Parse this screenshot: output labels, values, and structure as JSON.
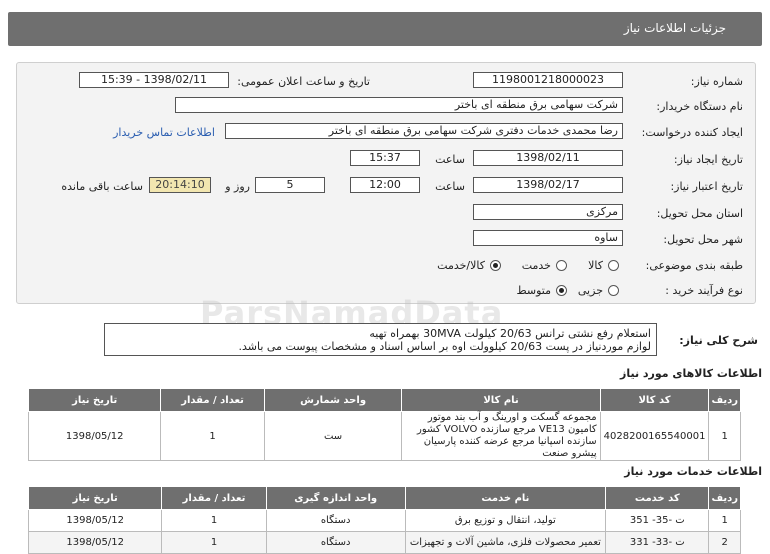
{
  "header": {
    "title": "جزئیات اطلاعات نیاز"
  },
  "form": {
    "need_number_label": "شماره نیاز:",
    "need_number": "1198001218000023",
    "announce_label": "تاریخ و ساعت اعلان عمومی:",
    "announce_value": "1398/02/11 - 15:39",
    "buyer_label": "نام دستگاه خریدار:",
    "buyer": "شرکت سهامی برق منطقه ای باختر",
    "requester_label": "ایجاد کننده درخواست:",
    "requester": "رضا محمدی خدمات دفتری شرکت سهامی برق منطقه ای باختر",
    "contact_link": "اطلاعات تماس خریدار",
    "created_label": "تاریخ ایجاد نیاز:",
    "created_date": "1398/02/11",
    "time_label": "ساعت",
    "created_time": "15:37",
    "valid_label": "تاریخ اعتبار نیاز:",
    "valid_date": "1398/02/17",
    "valid_time": "12:00",
    "days": "5",
    "days_label": "روز و",
    "remaining": "20:14:10",
    "remaining_label": "ساعت باقی مانده",
    "province_label": "استان محل تحویل:",
    "province": "مرکزی",
    "city_label": "شهر محل تحویل:",
    "city": "ساوه",
    "category_label": "طبقه بندی موضوعی:",
    "category_options": [
      "کالا",
      "خدمت",
      "کالا/خدمت"
    ],
    "category_selected": 2,
    "process_label": "نوع فرآیند خرید :",
    "process_options": [
      "جزیی",
      "متوسط"
    ],
    "process_selected": 1
  },
  "watermark": {
    "text": "ParsNamadData"
  },
  "description": {
    "label": "شرح کلی نیاز:",
    "line1": "استعلام رفع نشتی ترانس 20/63 کیلولت 30MVA بهمراه تهیه",
    "line2": "لوازم موردنیاز در پست 20/63 کیلوولت اوه  بر اساس اسناد و مشخصات پیوست می باشد."
  },
  "goods": {
    "title": "اطلاعات کالاهای مورد نیاز",
    "headers": [
      "ردیف",
      "کد کالا",
      "نام کالا",
      "واحد شمارش",
      "تعداد / مقدار",
      "تاریخ نیاز"
    ],
    "rows": [
      {
        "row": "1",
        "code": "4028200165540001",
        "name": "مجموعه گسکت و اورینگ و آب بند موتور کامیون VE13 مرجع سازنده VOLVO کشور سازنده اسپانیا مرجع عرضه کننده پارسیان پیشرو صنعت",
        "unit": "ست",
        "qty": "1",
        "date": "1398/05/12"
      }
    ]
  },
  "services": {
    "title": "اطلاعات خدمات مورد نیاز",
    "headers": [
      "ردیف",
      "کد خدمت",
      "نام خدمت",
      "واحد اندازه گیری",
      "تعداد / مقدار",
      "تاریخ نیاز"
    ],
    "rows": [
      {
        "row": "1",
        "code": "ت -35- 351",
        "name": "تولید، انتقال و توزیع برق",
        "unit": "دستگاه",
        "qty": "1",
        "date": "1398/05/12"
      },
      {
        "row": "2",
        "code": "ت -33- 331",
        "name": "تعمیر محصولات فلزی، ماشین آلات و تجهیزات",
        "unit": "دستگاه",
        "qty": "1",
        "date": "1398/05/12"
      }
    ]
  }
}
